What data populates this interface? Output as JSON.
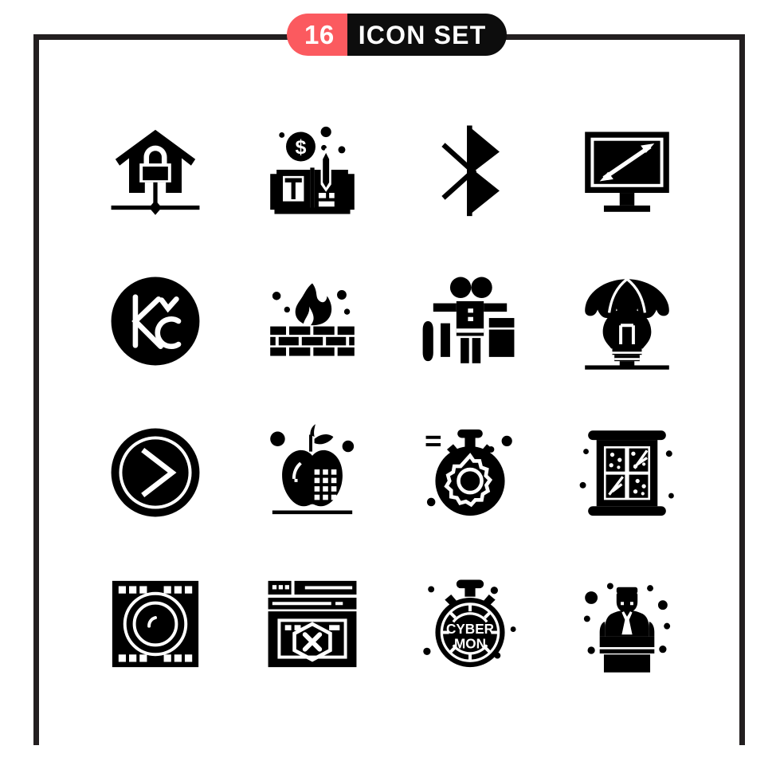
{
  "header": {
    "count": "16",
    "title": "ICON SET",
    "count_bg": "#fb5a5f",
    "title_bg": "#0d0d0d",
    "text_color": "#ffffff"
  },
  "frame": {
    "color": "#231f20",
    "thickness": "7"
  },
  "palette": {
    "icon_color": "#000000",
    "background": "#ffffff",
    "accent": "#fb5a5f"
  },
  "grid": {
    "columns": 4,
    "rows": 4,
    "total": 16
  },
  "icons": [
    {
      "index": 1,
      "name": "home-security-lock-icon",
      "label": "Home Security"
    },
    {
      "index": 2,
      "name": "finance-book-pencil-icon",
      "label": "Finance Book"
    },
    {
      "index": 3,
      "name": "bluetooth-icon",
      "label": "Bluetooth"
    },
    {
      "index": 4,
      "name": "screen-size-monitor-icon",
      "label": "Screen Size"
    },
    {
      "index": 5,
      "name": "czech-koruna-coin-icon",
      "label": "Koruna"
    },
    {
      "index": 6,
      "name": "firewall-brick-flame-icon",
      "label": "Firewall"
    },
    {
      "index": 7,
      "name": "scarecrow-figure-icon",
      "label": "Scarecrow"
    },
    {
      "index": 8,
      "name": "parachute-bulb-idea-icon",
      "label": "Idea Drop"
    },
    {
      "index": 9,
      "name": "next-chevron-circle-icon",
      "label": "Next"
    },
    {
      "index": 10,
      "name": "apple-grid-nutrition-icon",
      "label": "Apple Data"
    },
    {
      "index": 11,
      "name": "stopwatch-gear-icon",
      "label": "Time Settings"
    },
    {
      "index": 12,
      "name": "window-snow-panes-icon",
      "label": "Window"
    },
    {
      "index": 13,
      "name": "film-strip-lens-icon",
      "label": "Film Reel"
    },
    {
      "index": 14,
      "name": "browser-error-hexagon-icon",
      "label": "Page Error"
    },
    {
      "index": 15,
      "name": "cyber-monday-stopwatch-icon",
      "label": "Cyber Monday"
    },
    {
      "index": 16,
      "name": "podium-speaker-icon",
      "label": "Speaker"
    }
  ],
  "icon_labels": {
    "cyber_monday_line1": "CYBER",
    "cyber_monday_line2": "MON",
    "koruna_symbol": "Kč",
    "dollar_symbol": "$"
  }
}
